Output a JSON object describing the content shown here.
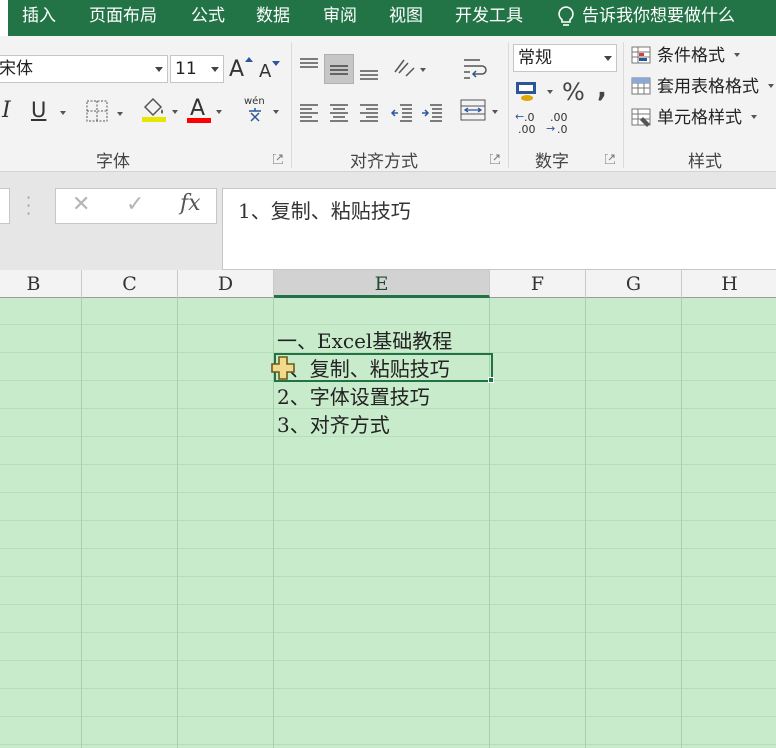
{
  "ribbon": {
    "tabs": [
      "插入",
      "页面布局",
      "公式",
      "数据",
      "审阅",
      "视图",
      "开发工具"
    ],
    "tell_me": "告诉我你想要做什么",
    "font": {
      "name": "宋体",
      "size": "11",
      "group_label": "字体",
      "grow_label": "A",
      "shrink_label": "A",
      "italic_label": "I",
      "underline_label": "U",
      "font_color_label": "A",
      "phonetic_label": "wén"
    },
    "alignment": {
      "group_label": "对齐方式"
    },
    "number": {
      "format": "常规",
      "group_label": "数字",
      "percent_label": "%",
      "comma_label": ",",
      "inc_decimal_label": ".00",
      "dec_decimal_label": ".0"
    },
    "styles": {
      "conditional": "条件格式",
      "table": "套用表格格式",
      "cell": "单元格样式",
      "group_label": "样式"
    },
    "colors": {
      "accent": "#227447",
      "fill_swatch": "#ffff00",
      "font_swatch": "#ff0000"
    }
  },
  "formula_bar": {
    "cancel_icon": "✕",
    "enter_icon": "✓",
    "fx_label": "fx",
    "value": "1、复制、粘贴技巧"
  },
  "columns": [
    "B",
    "C",
    "D",
    "E",
    "F",
    "G",
    "H"
  ],
  "selected_column": "E",
  "cells": [
    "一、Excel基础教程",
    "1、复制、粘贴技巧",
    "2、字体设置技巧",
    "3、对齐方式"
  ],
  "grid_color": "#c8ebcb"
}
